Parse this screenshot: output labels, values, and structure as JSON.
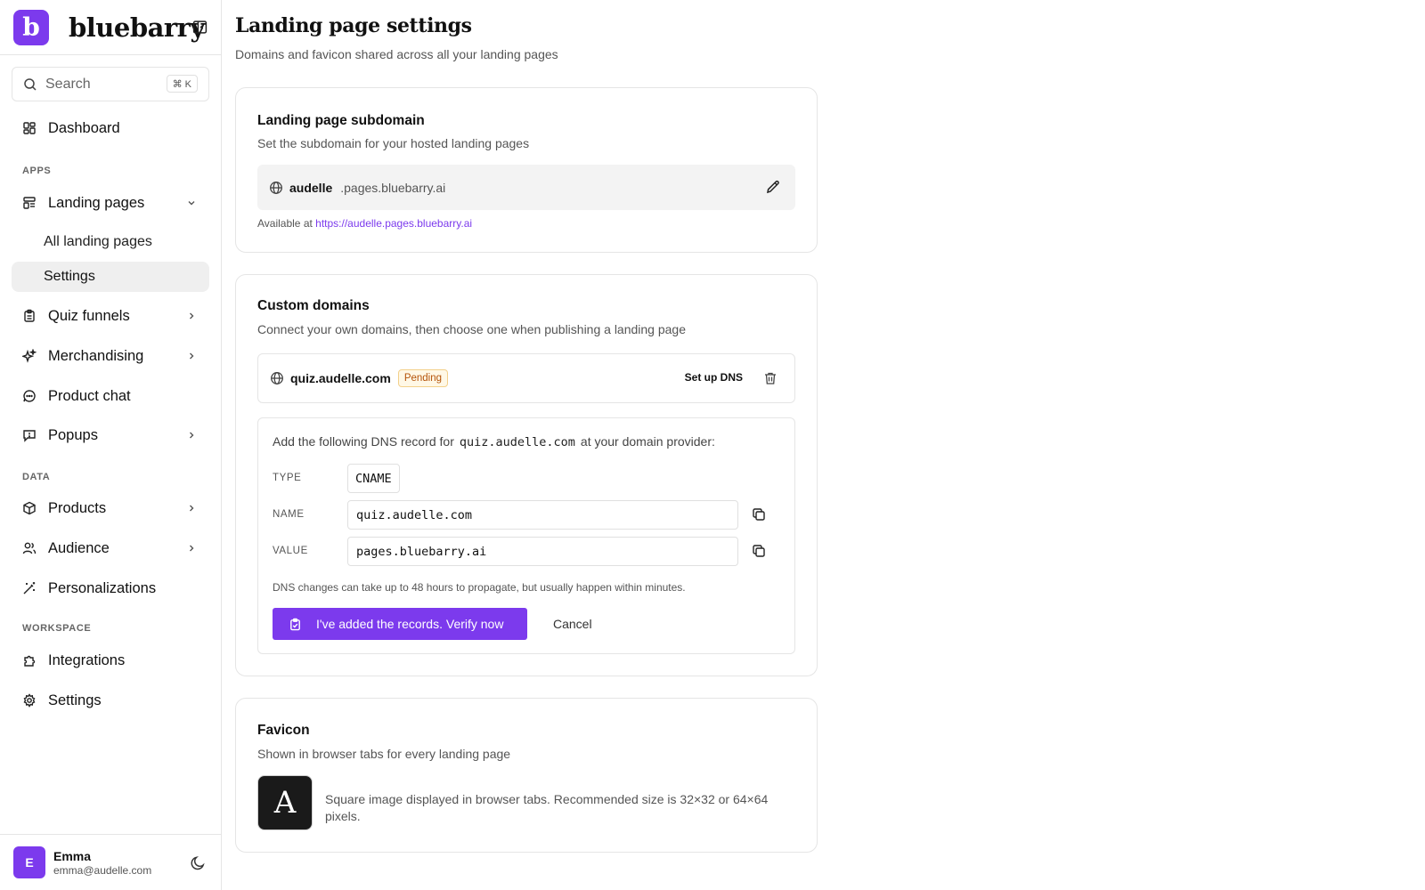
{
  "brand": {
    "logo_letter": "b",
    "name": "bluebarry",
    "accent": "#7c3aed"
  },
  "search": {
    "label": "Search",
    "shortcut": "⌘ K"
  },
  "sidebar": {
    "dashboard": "Dashboard",
    "sections": {
      "apps": "APPS",
      "data": "DATA",
      "workspace": "WORKSPACE"
    },
    "landing_pages": "Landing pages",
    "landing_sub": {
      "all": "All landing pages",
      "settings": "Settings"
    },
    "quiz_funnels": "Quiz funnels",
    "merchandising": "Merchandising",
    "product_chat": "Product chat",
    "popups": "Popups",
    "products": "Products",
    "audience": "Audience",
    "personalizations": "Personalizations",
    "integrations": "Integrations",
    "settings": "Settings"
  },
  "user": {
    "initial": "E",
    "name": "Emma",
    "email": "emma@audelle.com"
  },
  "page": {
    "title": "Landing page settings",
    "subtitle": "Domains and favicon shared across all your landing pages"
  },
  "subdomain_card": {
    "title": "Landing page subdomain",
    "desc": "Set the subdomain for your hosted landing pages",
    "subdomain": "audelle",
    "suffix": ".pages.bluebarry.ai",
    "available_prefix": "Available at ",
    "available_url": "https://audelle.pages.bluebarry.ai"
  },
  "custom_domains": {
    "title": "Custom domains",
    "desc": "Connect your own domains, then choose one when publishing a landing page",
    "domain": "quiz.audelle.com",
    "status": "Pending",
    "setup_dns": "Set up DNS",
    "dns": {
      "intro_before": "Add the following DNS record for",
      "intro_domain": "quiz.audelle.com",
      "intro_after": "at your domain provider:",
      "type_label": "TYPE",
      "type_value": "CNAME",
      "name_label": "NAME",
      "name_value": "quiz.audelle.com",
      "value_label": "VALUE",
      "value_value": "pages.bluebarry.ai",
      "note": "DNS changes can take up to 48 hours to propagate, but usually happen within minutes.",
      "verify_label": "I've added the records. Verify now",
      "cancel_label": "Cancel"
    }
  },
  "favicon": {
    "title": "Favicon",
    "desc": "Shown in browser tabs for every landing page",
    "letter": "A",
    "info": "Square image displayed in browser tabs. Recommended size is 32×32 or 64×64 pixels."
  }
}
